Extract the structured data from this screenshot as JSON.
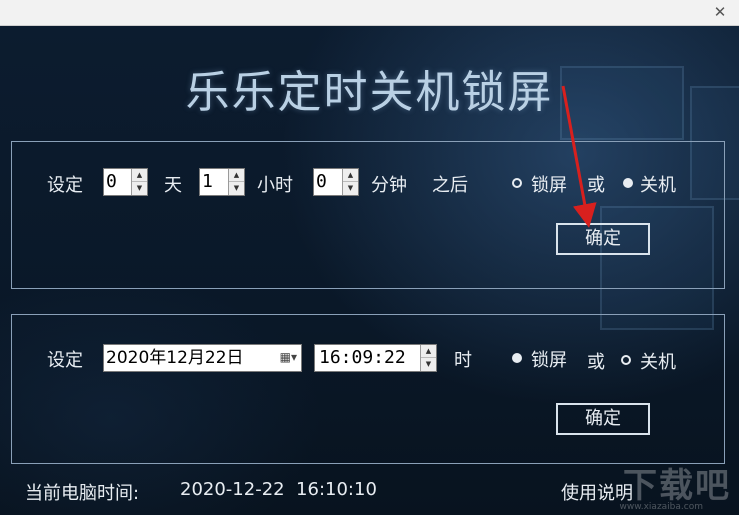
{
  "window": {
    "close_glyph": "✕"
  },
  "app_title": "乐乐定时关机锁屏",
  "countdown_panel": {
    "set_label": "设定",
    "days": {
      "value": "0",
      "unit": "天"
    },
    "hours": {
      "value": "1",
      "unit": "小时"
    },
    "minutes": {
      "value": "0",
      "unit": "分钟"
    },
    "after_label": "之后",
    "option_lock": "锁屏",
    "or_label": "或",
    "option_shutdown": "关机",
    "selected": "shutdown",
    "confirm_label": "确定"
  },
  "schedule_panel": {
    "set_label": "设定",
    "date_value": "2020年12月22日",
    "time_value": "16:09:22",
    "time_unit": "时",
    "option_lock": "锁屏",
    "or_label": "或",
    "option_shutdown": "关机",
    "selected": "lock",
    "confirm_label": "确定"
  },
  "footer": {
    "current_time_label": "当前电脑时间:",
    "current_time_value": "2020-12-22  16:10:10",
    "help_link": "使用说明"
  },
  "watermark": {
    "text": "下载吧",
    "sub": "www.xiazaiba.com"
  },
  "colors": {
    "background": "#0b1a2c",
    "text": "#e8edf2",
    "title": "#b9d0e4",
    "annotation_arrow": "#d8201e"
  }
}
